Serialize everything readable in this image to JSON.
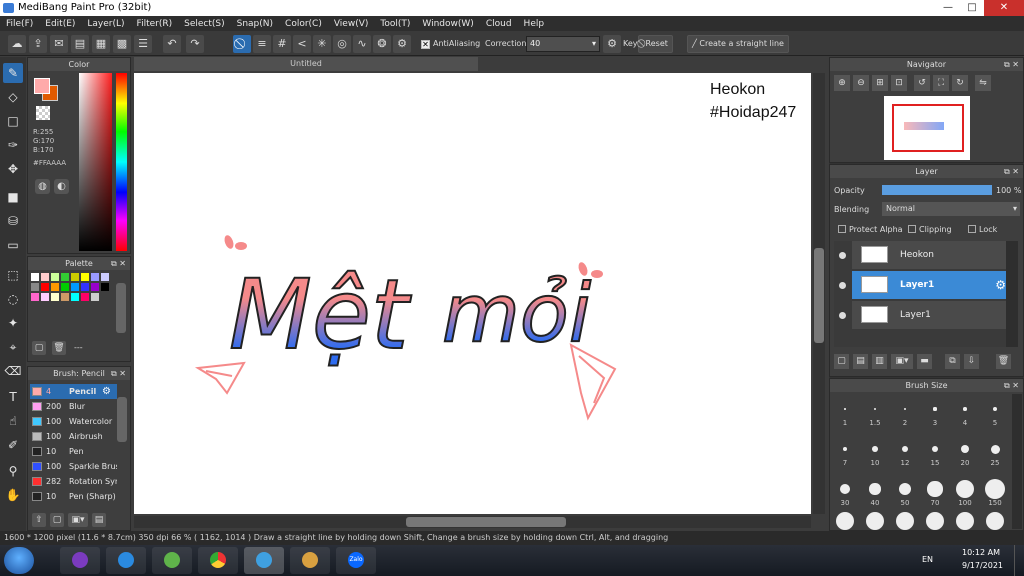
{
  "window": {
    "title": "MediBang Paint Pro (32bit)",
    "min": "—",
    "max": "□",
    "close": "✕"
  },
  "menu": [
    "File(F)",
    "Edit(E)",
    "Layer(L)",
    "Filter(R)",
    "Select(S)",
    "Snap(N)",
    "Color(C)",
    "View(V)",
    "Tool(T)",
    "Window(W)",
    "Cloud",
    "Help"
  ],
  "toolbar": {
    "antialiasing": "AntiAliasing",
    "correction_label": "Correction",
    "correction_value": "40",
    "key_label": "Key",
    "reset": "Reset",
    "straight_line": "Create a straight line"
  },
  "color_panel": {
    "title": "Color",
    "r": "R:255",
    "g": "G:170",
    "b": "B:170",
    "hex": "#FFAAAA",
    "fg": "#ffaaaa",
    "bg": "#e05a00"
  },
  "palette_panel": {
    "title": "Palette",
    "extra": "---"
  },
  "brush_panel": {
    "title": "Brush: Pencil",
    "items": [
      {
        "size": "4",
        "name": "Pencil",
        "color": "#ffaaaa"
      },
      {
        "size": "200",
        "name": "Blur",
        "color": "#ff9ff0"
      },
      {
        "size": "100",
        "name": "Watercolor",
        "color": "#40c8ff"
      },
      {
        "size": "100",
        "name": "Airbrush",
        "color": "#bbbbbb"
      },
      {
        "size": "10",
        "name": "Pen",
        "color": "#222222"
      },
      {
        "size": "100",
        "name": "Sparkle Brush",
        "color": "#3050ff"
      },
      {
        "size": "282",
        "name": "Rotation Sym",
        "color": "#ff3030"
      },
      {
        "size": "10",
        "name": "Pen (Sharp)",
        "color": "#222222"
      }
    ]
  },
  "canvas": {
    "tab": "Untitled",
    "watermark1": "Heokon",
    "watermark2": "#Hoidap247",
    "art_word1": "Mệt",
    "art_word2": "mỏi"
  },
  "navigator": {
    "title": "Navigator"
  },
  "layer_panel": {
    "title": "Layer",
    "opacity_label": "Opacity",
    "opacity_value": "100 %",
    "opacity": 1.0,
    "blending_label": "Blending",
    "blending_value": "Normal",
    "protect_alpha": "Protect Alpha",
    "clipping": "Clipping",
    "lock": "Lock",
    "layers": [
      "Heokon",
      "Layer1",
      "Layer1"
    ]
  },
  "brush_size": {
    "title": "Brush Size",
    "labels": [
      "1",
      "1.5",
      "2",
      "3",
      "4",
      "5",
      "7",
      "10",
      "12",
      "15",
      "20",
      "25",
      "30",
      "40",
      "50",
      "70",
      "100",
      "150"
    ]
  },
  "status": {
    "text": "1600 * 1200 pixel  (11.6 * 8.7cm)  350 dpi   66 %   ( 1162, 1014 )   Draw a straight line by holding down Shift, Change a brush size by holding down Ctrl, Alt, and dragging"
  },
  "taskbar": {
    "lang": "EN",
    "time": "10:12 AM",
    "date": "9/17/2021",
    "zalo": "Zalo"
  }
}
